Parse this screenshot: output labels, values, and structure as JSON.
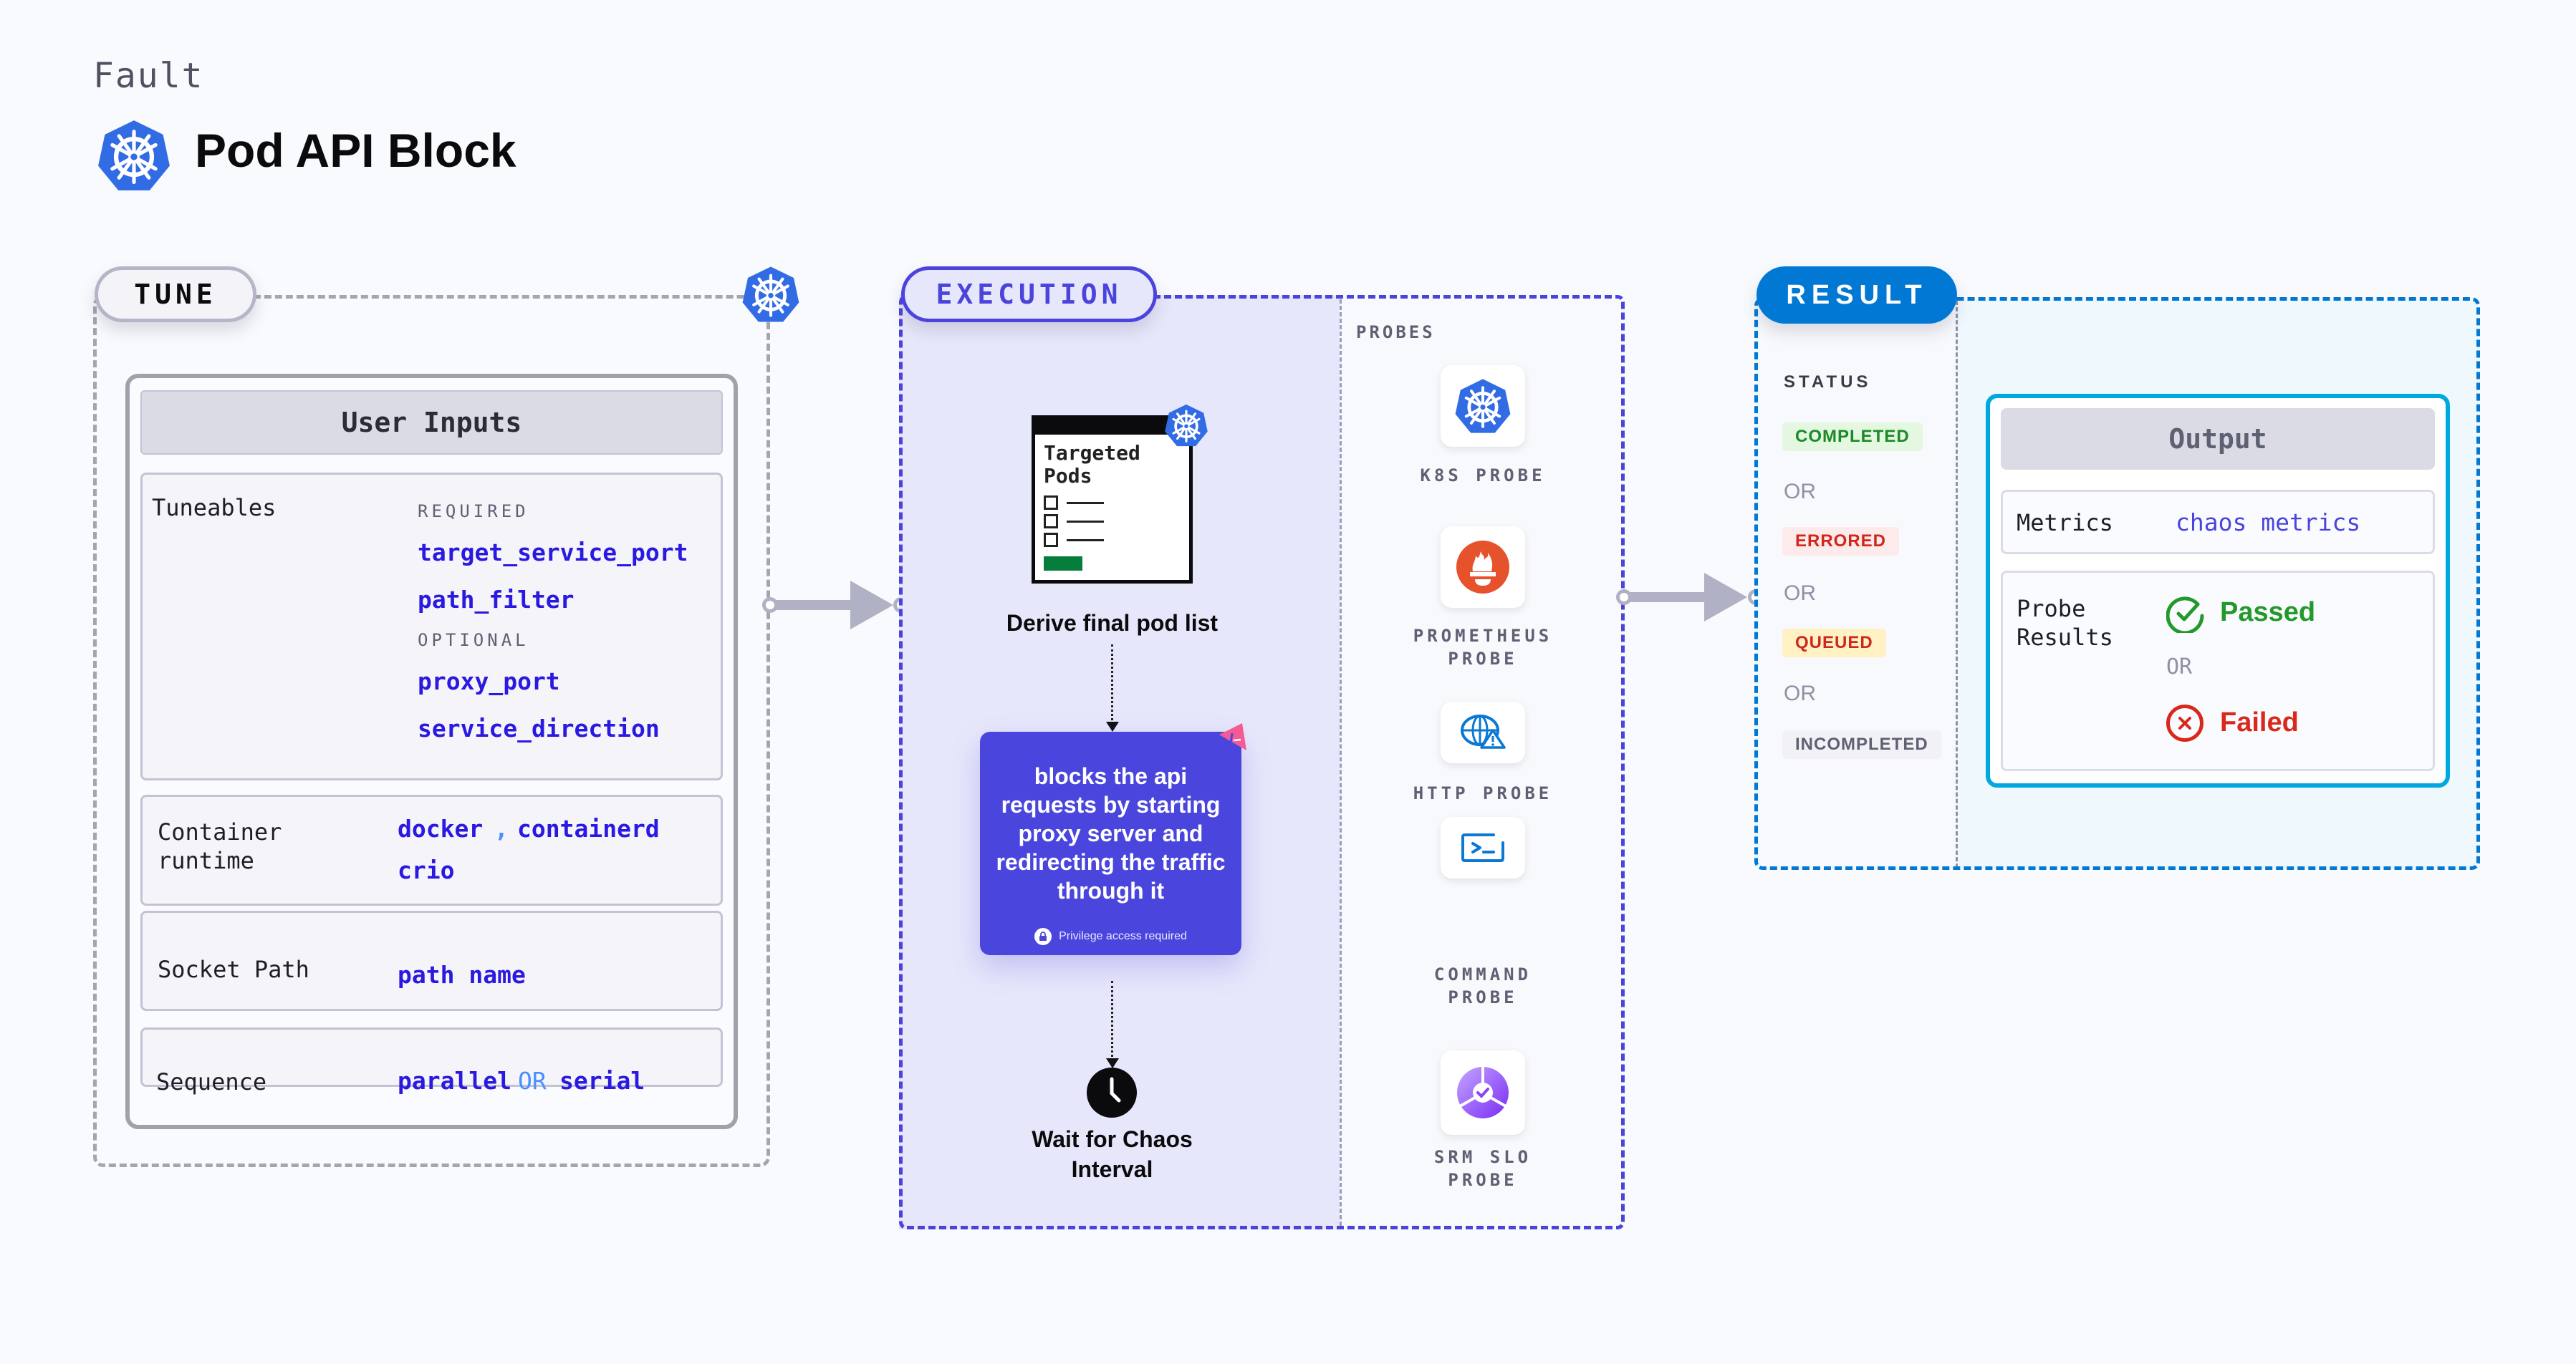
{
  "header": {
    "kicker": "Fault",
    "title": "Pod API Block",
    "title_icon": "kubernetes-icon"
  },
  "colors": {
    "kubernetes_blue": "#326ce5",
    "execution_accent": "#4a44dd",
    "result_accent": "#0278d5",
    "output_border": "#00a8e0",
    "value_text": "#2a19e0",
    "passed": "#22992a",
    "failed": "#d9281c"
  },
  "tune": {
    "pill": "TUNE",
    "card_title": "User Inputs",
    "tuneables": {
      "label": "Tuneables",
      "required_label": "REQUIRED",
      "required": [
        "target_service_port",
        "path_filter"
      ],
      "optional_label": "OPTIONAL",
      "optional": [
        "proxy_port",
        "service_direction"
      ]
    },
    "container_runtime": {
      "label_line1": "Container",
      "label_line2": "runtime",
      "values": [
        "docker",
        "containerd",
        "crio"
      ],
      "separator": ","
    },
    "socket_path": {
      "label": "Socket Path",
      "value": "path name"
    },
    "sequence": {
      "label": "Sequence",
      "values": [
        "parallel",
        "serial"
      ],
      "separator": "OR"
    }
  },
  "execution": {
    "pill": "EXECUTION",
    "targeted_pods": {
      "title_line1": "Targeted",
      "title_line2": "Pods"
    },
    "step1": "Derive final pod list",
    "chaos_card": {
      "text": "blocks the api requests by starting proxy server and redirecting the traffic through it",
      "footer": "Privilege access required"
    },
    "step3_line1": "Wait for Chaos",
    "step3_line2": "Interval",
    "probes_title": "PROBES",
    "probes": [
      {
        "icon": "kubernetes-icon",
        "line1": "K8S PROBE",
        "line2": ""
      },
      {
        "icon": "prometheus-icon",
        "line1": "PROMETHEUS",
        "line2": "PROBE"
      },
      {
        "icon": "http-globe-warning-icon",
        "line1": "HTTP PROBE",
        "line2": ""
      },
      {
        "icon": "terminal-icon",
        "line1": "COMMAND",
        "line2": "PROBE"
      },
      {
        "icon": "srm-slo-icon",
        "line1": "SRM SLO",
        "line2": "PROBE"
      }
    ]
  },
  "result": {
    "pill": "RESULT",
    "status_title": "STATUS",
    "statuses": [
      {
        "label": "COMPLETED",
        "fg": "#1b8a26",
        "bg": "#e4f7e1"
      },
      {
        "label": "ERRORED",
        "fg": "#d1261b",
        "bg": "#fdeaea"
      },
      {
        "label": "QUEUED",
        "fg": "#d1261b",
        "bg": "#fff1c4"
      },
      {
        "label": "INCOMPLETED",
        "fg": "#5e6073",
        "bg": "#f1f1f6"
      }
    ],
    "or_label": "OR",
    "output": {
      "title": "Output",
      "metrics_label": "Metrics",
      "metrics_value": "chaos metrics",
      "probe_results_line1": "Probe",
      "probe_results_line2": "Results",
      "passed": "Passed",
      "or": "OR",
      "failed": "Failed"
    }
  }
}
